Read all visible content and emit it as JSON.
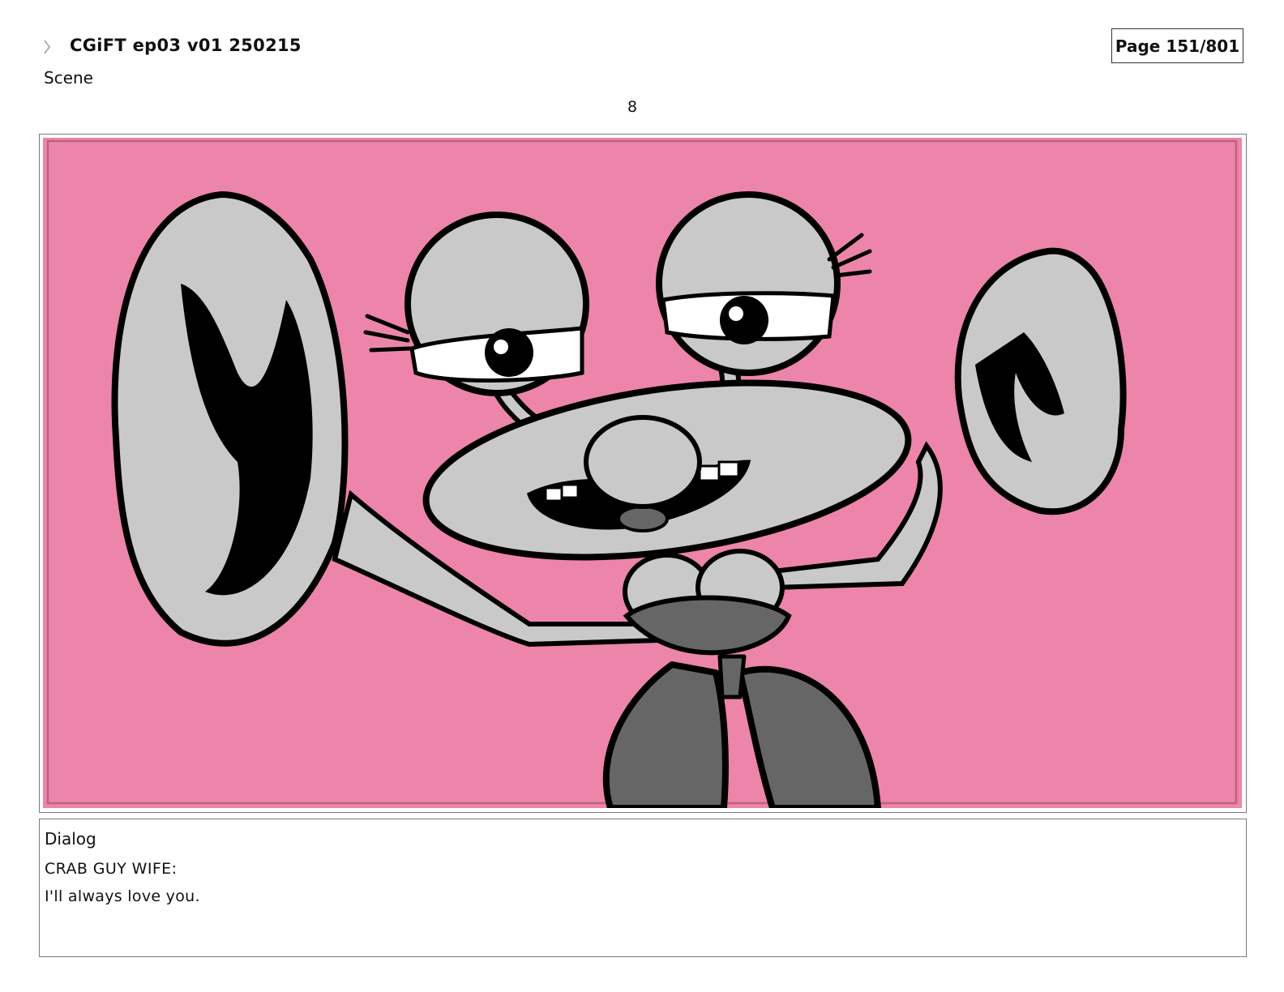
{
  "header": {
    "title": "CGiFT ep03 v01 250215",
    "page_indicator": "Page 151/801",
    "icon": "ribbon-marker-icon"
  },
  "scene": {
    "label": "Scene",
    "number": "8"
  },
  "panel": {
    "background_color": "#ec85a9",
    "inner_border_color": "#c05f86",
    "figure_light": "#c9c9c9",
    "figure_dark": "#666666",
    "outline": "#000000"
  },
  "dialog": {
    "heading": "Dialog",
    "speaker": "CRAB GUY WIFE:",
    "line": "I'll always love you."
  }
}
